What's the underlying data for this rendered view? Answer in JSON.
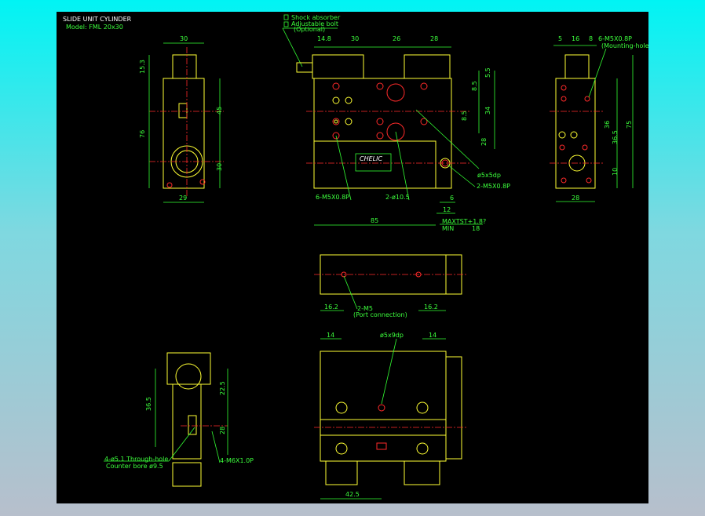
{
  "title": "SLIDE UNIT CYLINDER",
  "model": "Model: FML 20x30",
  "legend": {
    "shock": "Shock absorber",
    "bolt": "Adjustable bolt",
    "optional": "(Optional)"
  },
  "left_view": {
    "top": "30",
    "h1": "15.3",
    "h2": "76",
    "h3": "45",
    "h4": "30",
    "bottom": "29"
  },
  "front_view": {
    "d1": "14.8",
    "d2": "30",
    "d3": "26",
    "d4": "28",
    "v1": "5.5",
    "v2": "8.5",
    "v3": "34",
    "v4": "8.5",
    "v5": "28",
    "hole": "ø5x5dp",
    "port": "2-M5X0.8P",
    "tap": "6-M5X0.8P",
    "bore": "2-ø10.5",
    "s6": "6",
    "s12": "12",
    "len": "85",
    "maxst": "MAXTST+1.8?",
    "min": "MIN",
    "min_val": "18",
    "brand": "CHELIC"
  },
  "right_view": {
    "d1": "5",
    "d2": "16",
    "d3": "8",
    "tap": "6-M5X0.8P",
    "tap_note": "(Mounting-hole)",
    "v1": "36",
    "v2": "75",
    "v3": "36.5",
    "v4": "10",
    "bottom": "28"
  },
  "middle_view": {
    "left": "16.2",
    "port": "2-M5",
    "port_note": "(Port connection)",
    "right": "16.2"
  },
  "bottom_view": {
    "d1": "14",
    "hole": "ø5x9dp",
    "d2": "14",
    "len": "42.5"
  },
  "bottom_left_view": {
    "v1": "36.5",
    "v2": "22.5",
    "v3": "28",
    "through": "4-ø5.1 Through-hole",
    "counter": "Counter bore ø9.5",
    "tap": "4-M6X1.0P"
  }
}
